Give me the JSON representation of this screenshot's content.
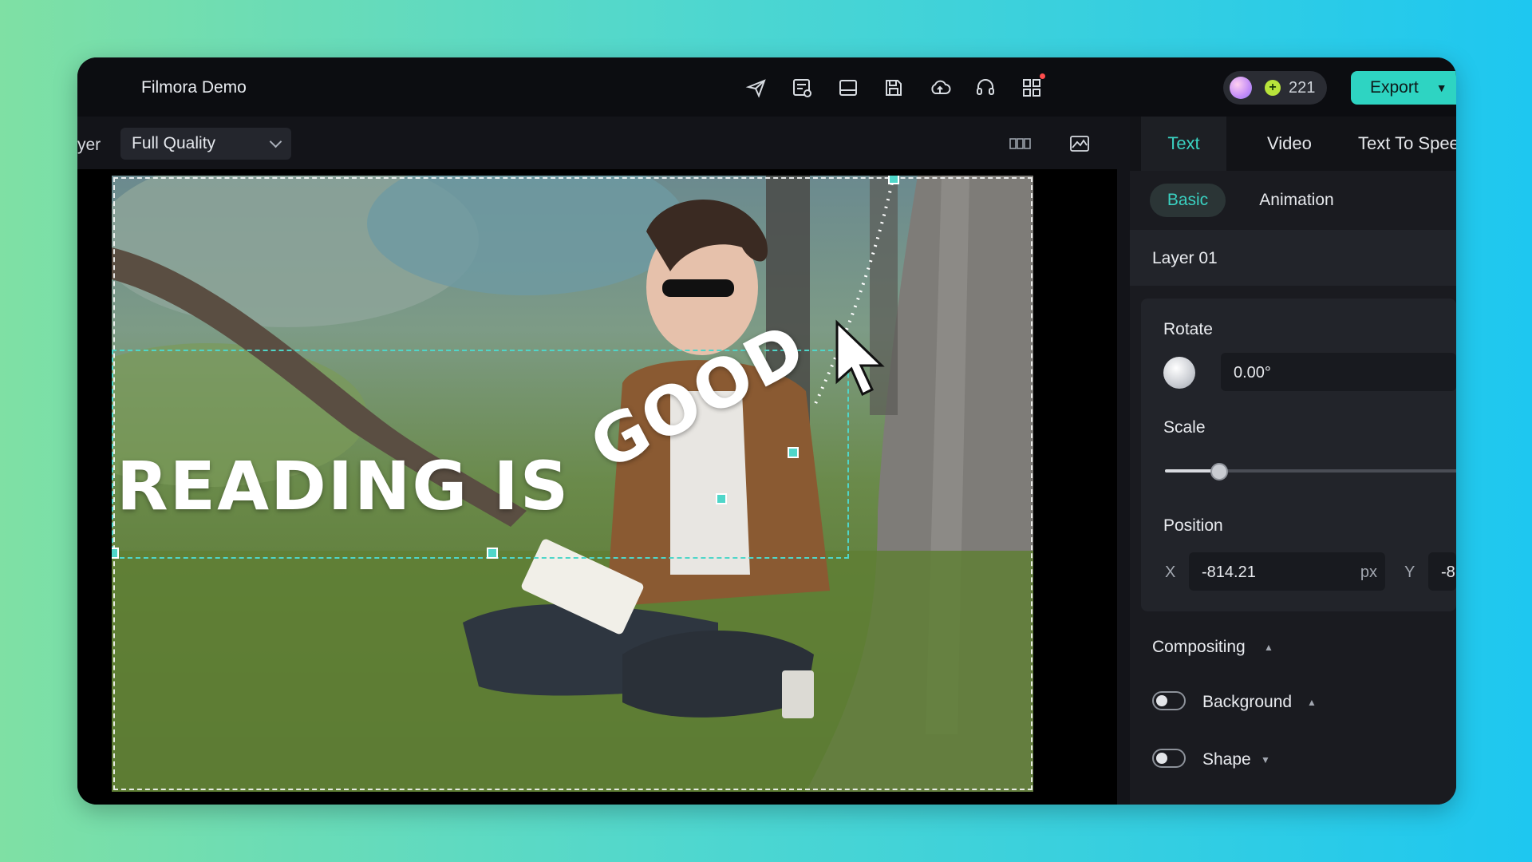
{
  "app": {
    "title": "Filmora Demo",
    "credits": "221",
    "export_label": "Export"
  },
  "colors": {
    "accent": "#2ed4c2",
    "window_bg": "#131419",
    "panel_bg": "#1a1b20"
  },
  "toolbar_icons": [
    "send-icon",
    "subtitles-icon",
    "layout-icon",
    "save-icon",
    "cloud-upload-icon",
    "headset-icon",
    "apps-grid-icon"
  ],
  "preview": {
    "layer_label_cut": "yer",
    "quality": "Full Quality",
    "overlay_text_straight": "READING IS ",
    "overlay_text_curved": "GOOD"
  },
  "panel": {
    "tabs": [
      "Text",
      "Video",
      "Text To Speech"
    ],
    "subtabs": [
      "Basic",
      "Animation"
    ],
    "layer": "Layer 01",
    "rotate_label": "Rotate",
    "rotate_value": "0.00°",
    "scale_label": "Scale",
    "scale_fraction": 0.18,
    "position_label": "Position",
    "x_label": "X",
    "x_value": "-814.21",
    "unit": "px",
    "y_label": "Y",
    "y_value": "-8",
    "compositing": "Compositing",
    "background": "Background",
    "shape": "Shape"
  }
}
